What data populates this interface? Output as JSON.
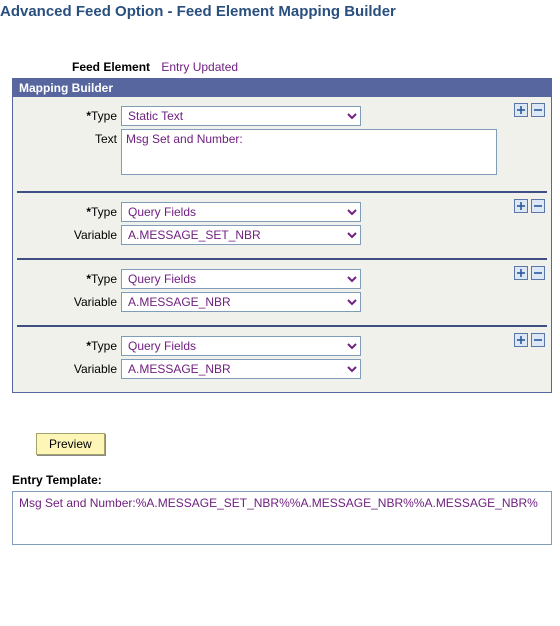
{
  "title": "Advanced Feed Option - Feed Element Mapping Builder",
  "feed_element": {
    "label": "Feed Element",
    "value": "Entry Updated"
  },
  "builder": {
    "header": "Mapping Builder",
    "labels": {
      "type": "Type",
      "text": "Text",
      "variable": "Variable"
    },
    "type_options": {
      "static_text": "Static Text",
      "query_fields": "Query Fields"
    },
    "blocks": [
      {
        "type": "Static Text",
        "text": "Msg Set and Number:"
      },
      {
        "type": "Query Fields",
        "variable": "A.MESSAGE_SET_NBR"
      },
      {
        "type": "Query Fields",
        "variable": "A.MESSAGE_NBR"
      },
      {
        "type": "Query Fields",
        "variable": "A.MESSAGE_NBR"
      }
    ]
  },
  "preview_label": "Preview",
  "entry_template": {
    "label": "Entry Template:",
    "value": "Msg Set and Number:%A.MESSAGE_SET_NBR%%A.MESSAGE_NBR%%A.MESSAGE_NBR%"
  }
}
